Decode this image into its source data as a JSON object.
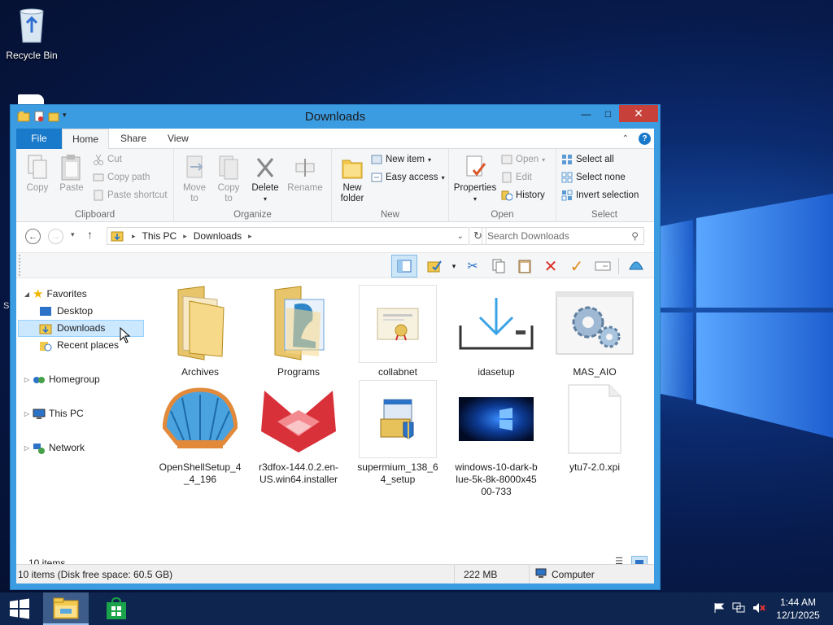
{
  "desktop": {
    "icons": [
      {
        "label": "Recycle Bin",
        "icon": "recycle-bin-icon"
      }
    ],
    "partial_text": "S"
  },
  "window": {
    "title": "Downloads",
    "ribbon_tabs": [
      "File",
      "Home",
      "Share",
      "View"
    ],
    "clipboard": {
      "group_label": "Clipboard",
      "copy": "Copy",
      "paste": "Paste",
      "cut": "Cut",
      "copy_path": "Copy path",
      "paste_shortcut": "Paste shortcut"
    },
    "organize": {
      "group_label": "Organize",
      "move_to": "Move to",
      "copy_to": "Copy to",
      "delete": "Delete",
      "rename": "Rename"
    },
    "new": {
      "group_label": "New",
      "new_folder": "New folder",
      "new_item": "New item",
      "easy_access": "Easy access"
    },
    "open": {
      "group_label": "Open",
      "properties": "Properties",
      "open": "Open",
      "edit": "Edit",
      "history": "History"
    },
    "select": {
      "group_label": "Select",
      "select_all": "Select all",
      "select_none": "Select none",
      "invert_selection": "Invert selection"
    },
    "address": {
      "crumbs": [
        "This PC",
        "Downloads"
      ],
      "search_placeholder": "Search Downloads"
    },
    "nav_pane": {
      "favorites": "Favorites",
      "desktop": "Desktop",
      "downloads": "Downloads",
      "recent_places": "Recent places",
      "homegroup": "Homegroup",
      "this_pc": "This PC",
      "network": "Network"
    },
    "files": [
      {
        "name": "Archives",
        "icon": "folder-icon"
      },
      {
        "name": "Programs",
        "icon": "folder-icon"
      },
      {
        "name": "collabnet",
        "icon": "certificate-icon"
      },
      {
        "name": "idasetup",
        "icon": "download-icon"
      },
      {
        "name": "MAS_AIO",
        "icon": "script-gears-icon"
      },
      {
        "name": "OpenShellSetup_4_4_196",
        "icon": "shell-icon"
      },
      {
        "name": "r3dfox-144.0.2.en-US.win64.installer",
        "icon": "fox-icon"
      },
      {
        "name": "supermium_138_64_setup",
        "icon": "installer-icon"
      },
      {
        "name": "windows-10-dark-blue-5k-8k-8000x4500-733",
        "icon": "image-icon"
      },
      {
        "name": "ytu7-2.0.xpi",
        "icon": "blank-file-icon"
      }
    ],
    "item_count": "10 items",
    "status": {
      "summary": "10 items (Disk free space: 60.5 GB)",
      "size": "222 MB",
      "location": "Computer"
    }
  },
  "taskbar": {
    "time": "1:44 AM",
    "date": "12/1/2025"
  },
  "colors": {
    "accent": "#1979ca",
    "window_border": "#3b9ce2",
    "close": "#c7413a",
    "selection": "#cce8ff"
  }
}
